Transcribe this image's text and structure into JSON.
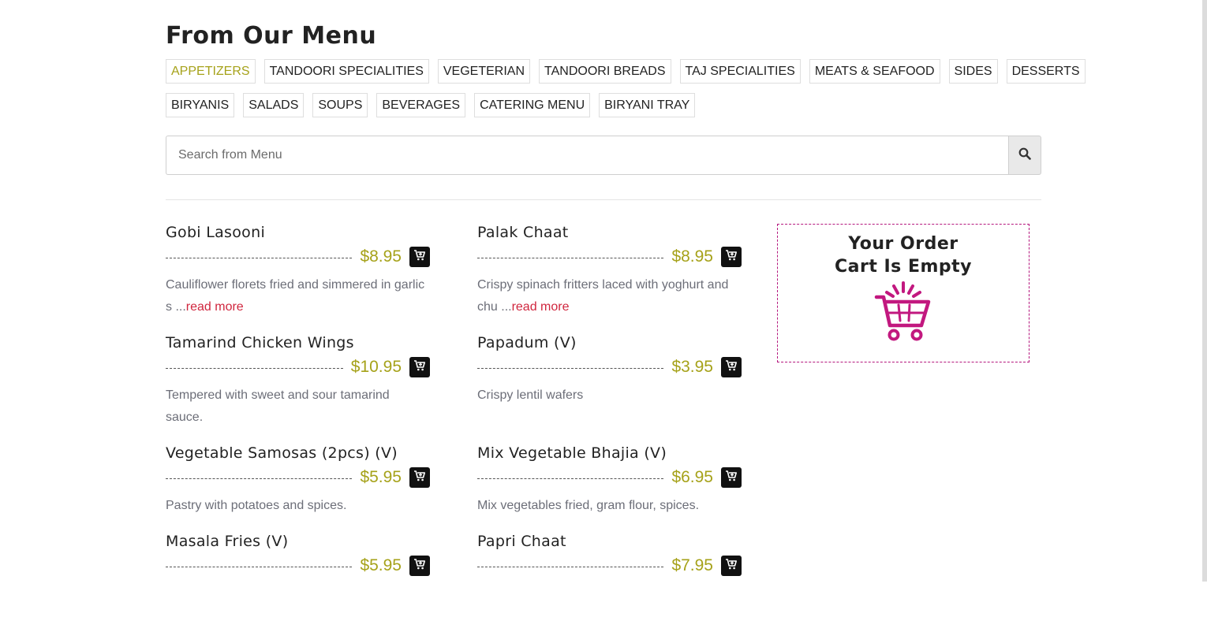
{
  "menu": {
    "title": "From Our Menu",
    "categories_row1": [
      {
        "label": "APPETIZERS",
        "active": true
      },
      {
        "label": "TANDOORI SPECIALITIES",
        "active": false
      },
      {
        "label": "VEGETERIAN",
        "active": false
      },
      {
        "label": "TANDOORI BREADS",
        "active": false
      },
      {
        "label": "TAJ SPECIALITIES",
        "active": false
      },
      {
        "label": "MEATS & SEAFOOD",
        "active": false
      },
      {
        "label": "SIDES",
        "active": false
      },
      {
        "label": "DESSERTS",
        "active": false
      }
    ],
    "categories_row2": [
      {
        "label": "BIRYANIS",
        "active": false
      },
      {
        "label": "SALADS",
        "active": false
      },
      {
        "label": "SOUPS",
        "active": false
      },
      {
        "label": "BEVERAGES",
        "active": false
      },
      {
        "label": "CATERING MENU",
        "active": false
      },
      {
        "label": "BIRYANI TRAY",
        "active": false
      }
    ]
  },
  "search": {
    "placeholder": "Search from Menu",
    "value": "",
    "button_icon": "search-icon"
  },
  "items": [
    {
      "name": "Gobi Lasooni",
      "price": "$8.95",
      "desc": "Cauliflower florets fried and simmered in garlic s ...",
      "read_more": "read more"
    },
    {
      "name": "Palak Chaat",
      "price": "$8.95",
      "desc": "Crispy spinach fritters laced with yoghurt and chu ...",
      "read_more": "read more"
    },
    {
      "name": "Tamarind Chicken Wings",
      "price": "$10.95",
      "desc": "Tempered with sweet and sour tamarind sauce.",
      "read_more": ""
    },
    {
      "name": "Papadum (V)",
      "price": "$3.95",
      "desc": "Crispy lentil wafers",
      "read_more": ""
    },
    {
      "name": "Vegetable Samosas (2pcs) (V)",
      "price": "$5.95",
      "desc": "Pastry with potatoes and spices.",
      "read_more": ""
    },
    {
      "name": "Mix Vegetable Bhajia (V)",
      "price": "$6.95",
      "desc": "Mix vegetables fried, gram flour, spices.",
      "read_more": ""
    },
    {
      "name": "Masala Fries (V)",
      "price": "$5.95",
      "desc": "",
      "read_more": ""
    },
    {
      "name": "Papri Chaat",
      "price": "$7.95",
      "desc": "",
      "read_more": ""
    }
  ],
  "cart": {
    "title_line1": "Your Order",
    "title_line2": "Cart Is Empty",
    "icon": "shopping-basket-icon",
    "accent_color": "#c2187f"
  },
  "colors": {
    "accent": "#a6a21a",
    "read_more": "#d0263e",
    "description": "#6c6e78"
  }
}
